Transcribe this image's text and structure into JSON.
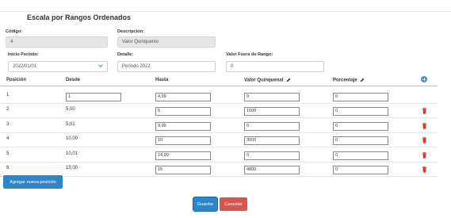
{
  "page": {
    "title": "Escala por Rangos Ordenados"
  },
  "form": {
    "codigo": {
      "label": "Código:",
      "value": "4"
    },
    "descripcion": {
      "label": "Descripción:",
      "value": "Valor Quinquenio"
    },
    "inicio_periodo": {
      "label": "Inicio Período:",
      "value": "2022/01/01"
    },
    "detalle": {
      "label": "Detalle:",
      "value": "Periodo 2022"
    },
    "valor_fuera_rango": {
      "label": "Valor Fuera de Rango:",
      "value": "0"
    }
  },
  "table": {
    "headers": {
      "posicion": "Posición",
      "desde": "Desde",
      "hasta": "Hasta",
      "valor_quinquenal": "Valor Quinquenal",
      "porcentaje": "Porcentaje"
    },
    "rows": [
      {
        "posicion": "1",
        "desde": "1",
        "hasta": "4,99",
        "valor": "0",
        "porcentaje": "0",
        "desde_editable": true,
        "deletable": false
      },
      {
        "posicion": "2",
        "desde": "5,00",
        "hasta": "5",
        "valor": "1500",
        "porcentaje": "0",
        "desde_editable": false,
        "deletable": true
      },
      {
        "posicion": "3",
        "desde": "5,01",
        "hasta": "9,99",
        "valor": "0",
        "porcentaje": "0",
        "desde_editable": false,
        "deletable": true
      },
      {
        "posicion": "4",
        "desde": "10,00",
        "hasta": "10",
        "valor": "3000",
        "porcentaje": "0",
        "desde_editable": false,
        "deletable": true
      },
      {
        "posicion": "5",
        "desde": "10,01",
        "hasta": "14,99",
        "valor": "0",
        "porcentaje": "0",
        "desde_editable": false,
        "deletable": true
      },
      {
        "posicion": "6",
        "desde": "15,00",
        "hasta": "15",
        "valor": "4800",
        "porcentaje": "0",
        "desde_editable": false,
        "deletable": true
      }
    ]
  },
  "buttons": {
    "add_position": "Agregar nueva posición",
    "save": "Guardar",
    "cancel": "Cancelar"
  },
  "icons": {
    "add_row": "plus-circle-icon",
    "delete_row": "trash-icon",
    "edit_column": "pencil-icon",
    "date_dropdown": "chevron-down-icon"
  },
  "colors": {
    "primary": "#2e86c9",
    "danger": "#d9534f",
    "add_icon": "#3c8dd8",
    "chevron": "#2aa87a"
  }
}
